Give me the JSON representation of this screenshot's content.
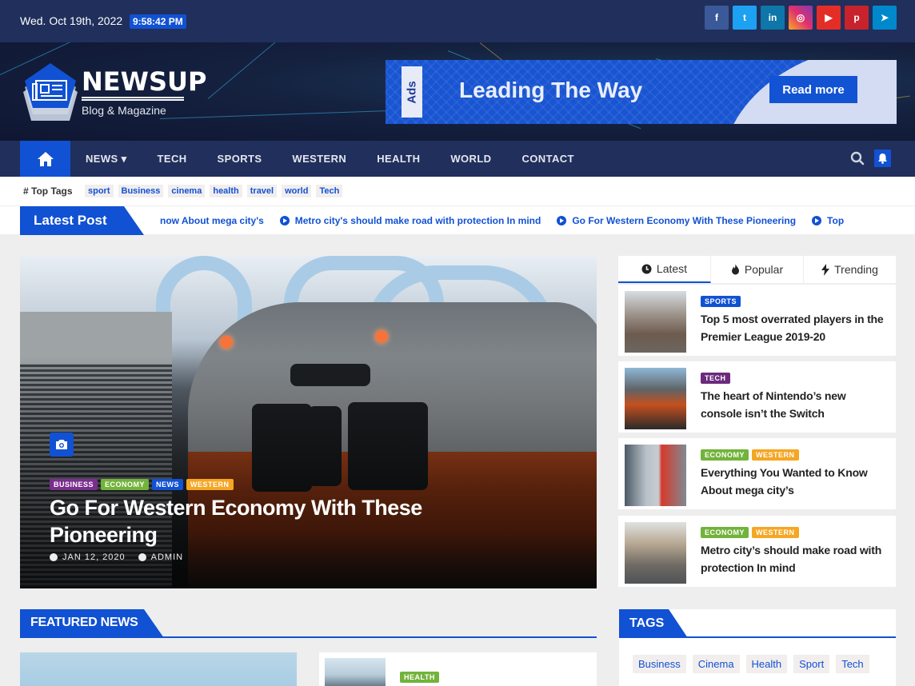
{
  "topbar": {
    "date": "Wed. Oct 19th, 2022",
    "time": "9:58:42 PM",
    "social": [
      {
        "name": "facebook",
        "glyph": "f",
        "color": "#3b5998"
      },
      {
        "name": "twitter",
        "glyph": "t",
        "color": "#1da1f2"
      },
      {
        "name": "linkedin",
        "glyph": "in",
        "color": "#0e76a8"
      },
      {
        "name": "instagram",
        "glyph": "◎",
        "color": "#e1306c"
      },
      {
        "name": "youtube",
        "glyph": "▶",
        "color": "#e52d27"
      },
      {
        "name": "pinterest",
        "glyph": "p",
        "color": "#c8232c"
      },
      {
        "name": "telegram",
        "glyph": "➤",
        "color": "#0088cc"
      }
    ]
  },
  "header": {
    "brand": "NEWSUP",
    "tagline": "Blog & Magazine",
    "ad": {
      "tag": "Ads",
      "headline": "Leading The Way",
      "button": "Read more"
    }
  },
  "nav": {
    "items": [
      "NEWS ▾",
      "TECH",
      "SPORTS",
      "WESTERN",
      "HEALTH",
      "WORLD",
      "CONTACT"
    ]
  },
  "top_tags": {
    "label": "# Top Tags",
    "tags": [
      "sport",
      "Business",
      "cinema",
      "health",
      "travel",
      "world",
      "Tech"
    ]
  },
  "ticker": {
    "label": "Latest Post",
    "items": [
      "now About mega city's",
      "Metro city's should make road with protection In mind",
      "Go For Western Economy With These Pioneering",
      "Top"
    ]
  },
  "hero": {
    "categories": [
      {
        "label": "BUSINESS",
        "color": "#7a2e8e"
      },
      {
        "label": "ECONOMY",
        "color": "#72b33b"
      },
      {
        "label": "NEWS",
        "color": "#1151d3"
      },
      {
        "label": "WESTERN",
        "color": "#f5a623"
      }
    ],
    "title": "Go For Western Economy With These Pioneering",
    "date": "JAN 12, 2020",
    "author": "ADMIN"
  },
  "sidebar": {
    "tabs": [
      "Latest",
      "Popular",
      "Trending"
    ],
    "active_tab": "Latest",
    "posts": [
      {
        "categories": [
          {
            "label": "SPORTS",
            "color": "#1151d3"
          }
        ],
        "title": "Top 5 most overrated players in the Premier League 2019-20"
      },
      {
        "categories": [
          {
            "label": "TECH",
            "color": "#6b2a7d"
          }
        ],
        "title": "The heart of Nintendo’s new console isn’t the Switch"
      },
      {
        "categories": [
          {
            "label": "ECONOMY",
            "color": "#72b33b"
          },
          {
            "label": "WESTERN",
            "color": "#f5a623"
          }
        ],
        "title": "Everything You Wanted to Know About mega city’s"
      },
      {
        "categories": [
          {
            "label": "ECONOMY",
            "color": "#72b33b"
          },
          {
            "label": "WESTERN",
            "color": "#f5a623"
          }
        ],
        "title": "Metro city’s should make road with protection In mind"
      }
    ]
  },
  "featured": {
    "title": "FEATURED NEWS",
    "card_category": {
      "label": "HEALTH",
      "color": "#72b33b"
    }
  },
  "tags_widget": {
    "title": "TAGS",
    "tags": [
      "Business",
      "Cinema",
      "Health",
      "Sport",
      "Tech"
    ]
  }
}
